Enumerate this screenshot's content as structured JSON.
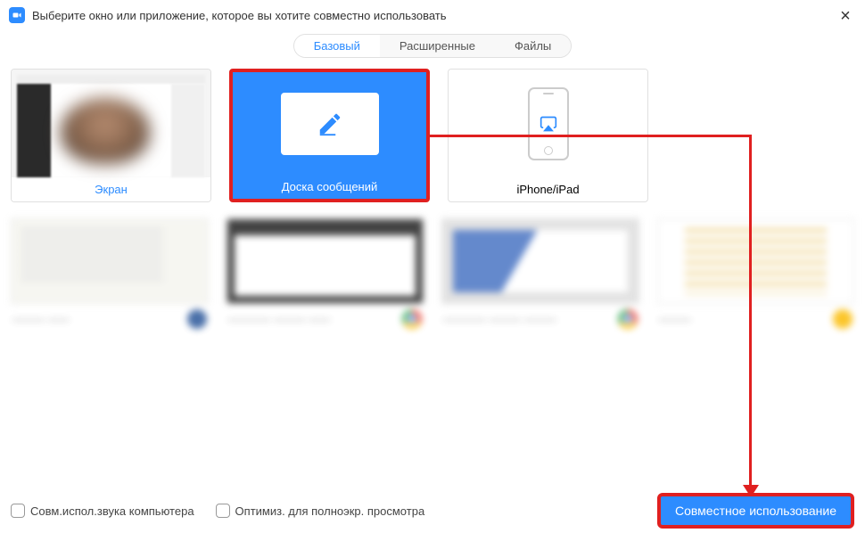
{
  "header": {
    "title": "Выберите окно или приложение, которое вы хотите совместно использовать"
  },
  "tabs": {
    "items": [
      {
        "label": "Базовый",
        "active": true
      },
      {
        "label": "Расширенные",
        "active": false
      },
      {
        "label": "Файлы",
        "active": false
      }
    ]
  },
  "options": {
    "screen": {
      "label": "Экран"
    },
    "whiteboard": {
      "label": "Доска сообщений"
    },
    "iphone": {
      "label": "iPhone/iPad"
    }
  },
  "footer": {
    "share_audio": "Совм.испол.звука компьютера",
    "optimize": "Оптимиз. для полноэкр. просмотра",
    "share_button": "Совместное использование"
  },
  "icons": {
    "app": "zoom-icon",
    "close": "×",
    "pencil": "pencil-icon",
    "airplay": "airplay-icon"
  }
}
